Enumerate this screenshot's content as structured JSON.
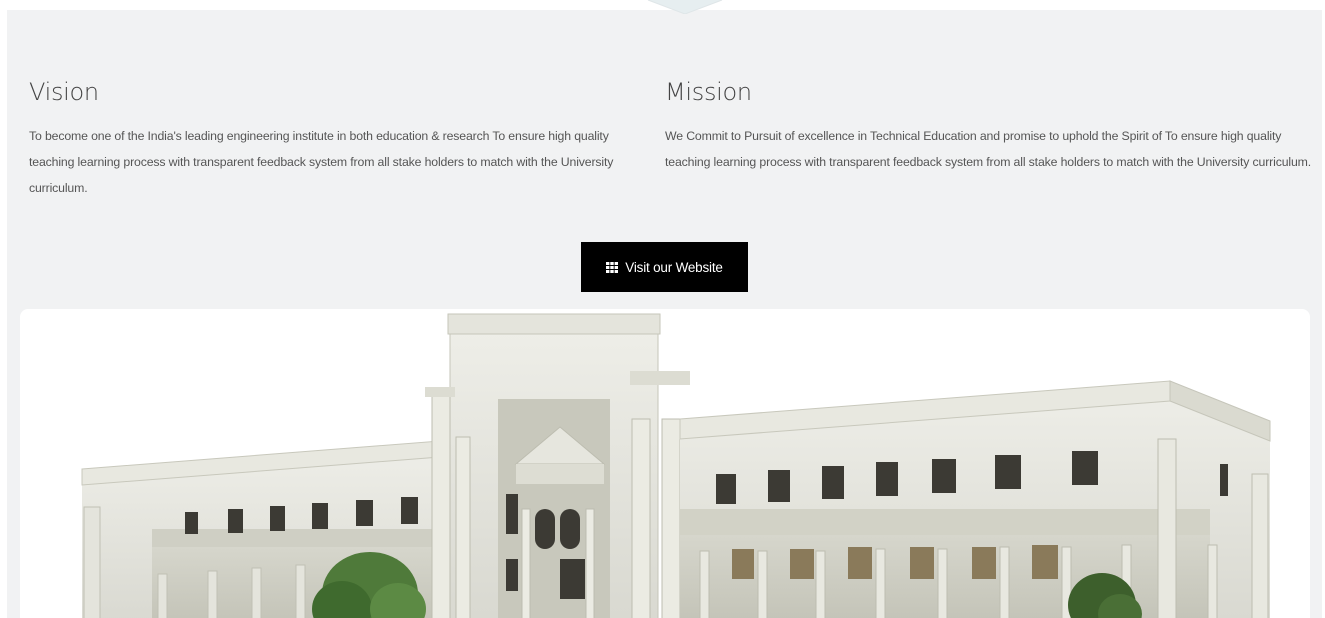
{
  "vision": {
    "heading": "Vision",
    "text": "To become one of the India's leading engineering institute in both education & research To ensure high quality teaching learning process with transparent feedback system from all stake holders to match with the University curriculum."
  },
  "mission": {
    "heading": "Mission",
    "text": "We Commit to Pursuit of excellence in Technical Education and promise to uphold the Spirit of To ensure high quality teaching learning process with transparent feedback system from all stake holders to match with the University curriculum."
  },
  "cta": {
    "label": "Visit our Website",
    "icon": "grid-icon"
  },
  "colors": {
    "panel_bg": "#f1f2f3",
    "button_bg": "#000000",
    "button_text": "#ffffff",
    "heading": "#444444",
    "body_text": "#555555"
  }
}
